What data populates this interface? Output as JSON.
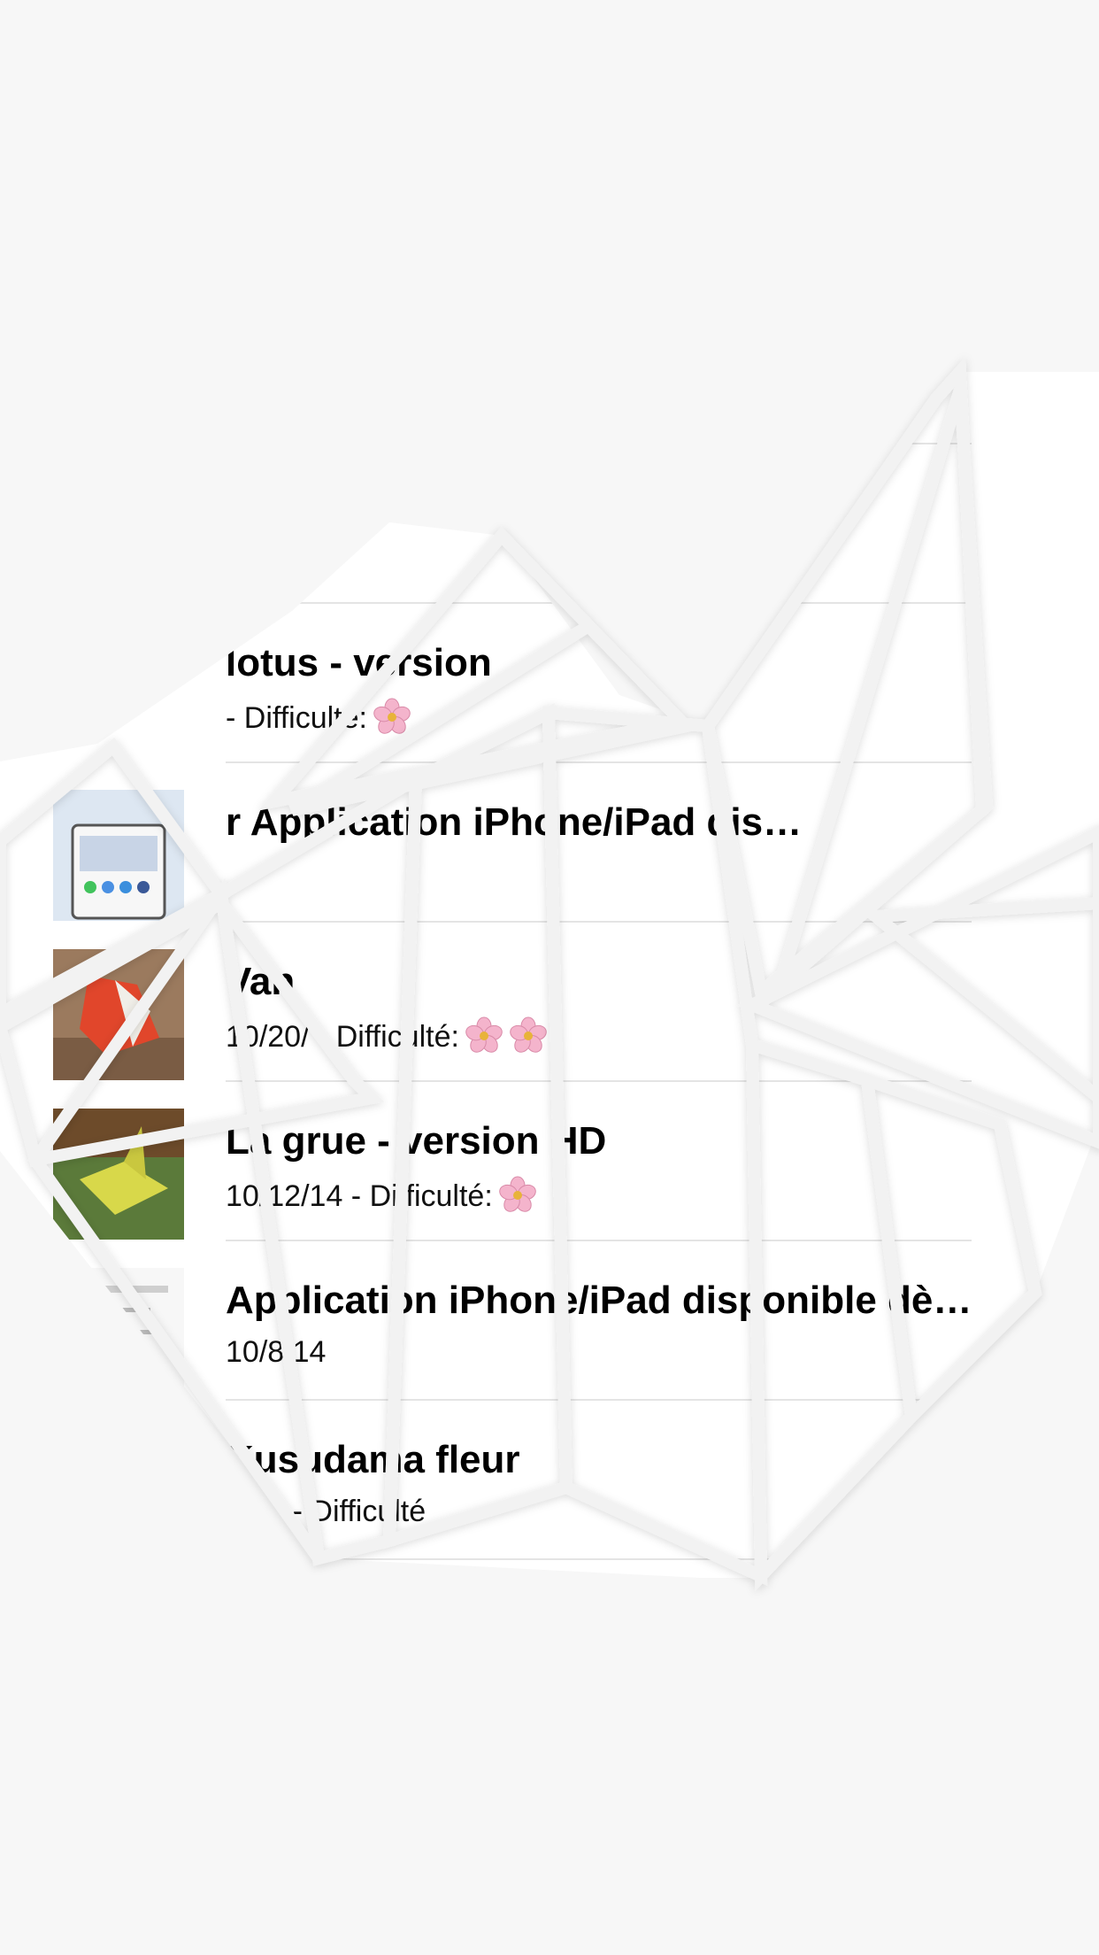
{
  "list": {
    "items": [
      {
        "title": "",
        "subtitle": "",
        "flowers": 0,
        "thumb": "none"
      },
      {
        "title": "",
        "subtitle": "",
        "flowers": 0,
        "thumb": "none"
      },
      {
        "title": "lotus - version",
        "subtitle": "- Difficulté:",
        "flowers": 1,
        "thumb": "none"
      },
      {
        "title": "r Application iPhone/iPad dis…",
        "subtitle": "",
        "flowers": 0,
        "thumb": "phone-screenshot"
      },
      {
        "title": "Van",
        "subtitle": "10/20/ - Difficulté:",
        "flowers": 2,
        "thumb": "origami-red-fox"
      },
      {
        "title": "La grue - version HD",
        "subtitle": "10/12/14 - Difficulté:",
        "flowers": 1,
        "thumb": "origami-yellow-crane"
      },
      {
        "title": "Application iPhone/iPad disponible dè…",
        "subtitle": "10/8/14",
        "flowers": 0,
        "thumb": "app-list-screenshot"
      },
      {
        "title": "Kusudama fleur",
        "subtitle": "9/14 - Difficulté",
        "flowers": 0,
        "thumb": "none"
      }
    ]
  },
  "icons": {
    "difficulty": "cherry-blossom-icon",
    "disclosure": "chevron-right-icon"
  },
  "colors": {
    "background": "#f7f7f7",
    "flower_petal": "#f4b4cc",
    "flower_center": "#e8b33a"
  }
}
